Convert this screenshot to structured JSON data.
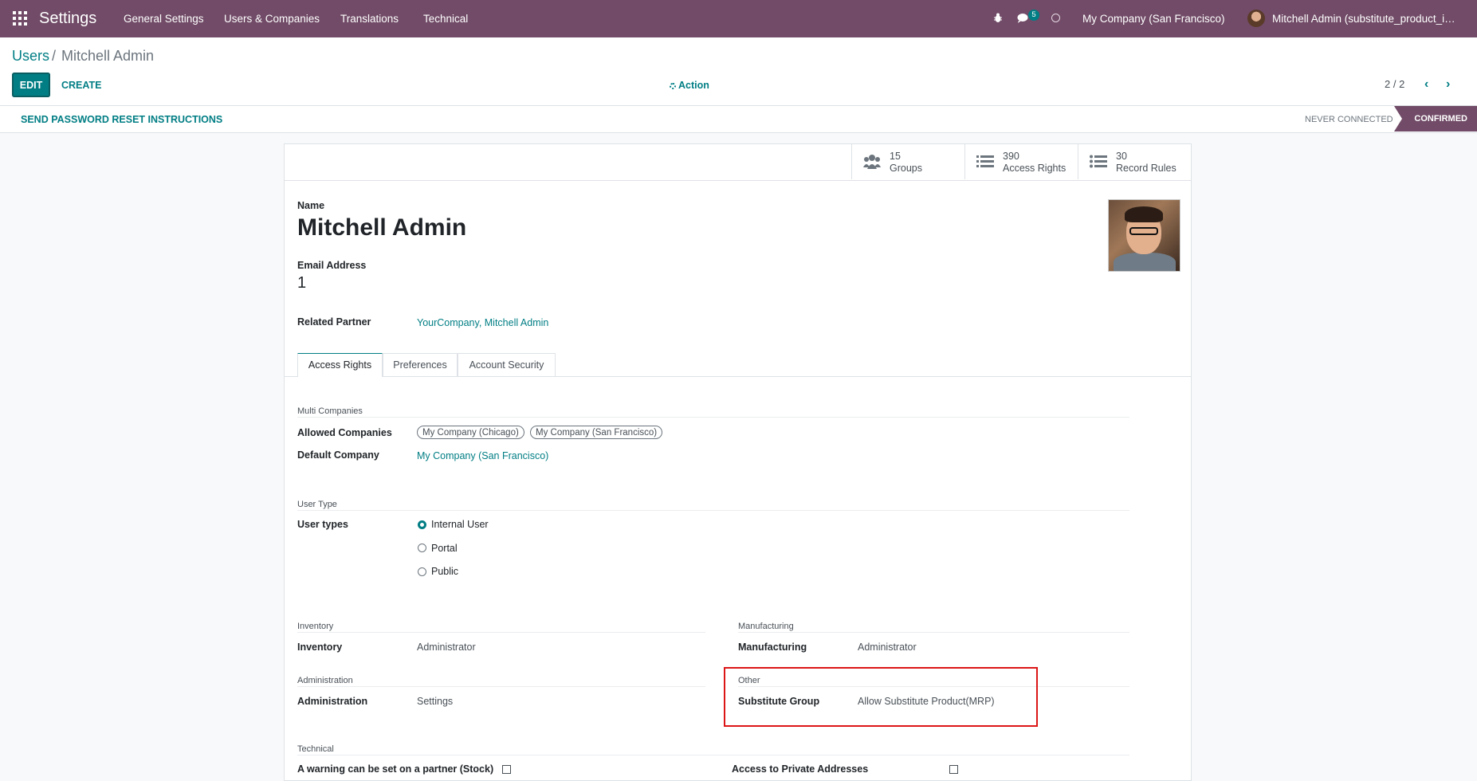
{
  "app": {
    "name": "Settings"
  },
  "top_menu": [
    "General Settings",
    "Users & Companies",
    "Translations",
    "Technical"
  ],
  "systray": {
    "chat_count": "5",
    "company": "My Company (San Francisco)",
    "user": "Mitchell Admin (substitute_product_in_..."
  },
  "breadcrumb": {
    "parent": "Users",
    "separator": "/",
    "current": "Mitchell Admin"
  },
  "buttons": {
    "edit": "EDIT",
    "create": "CREATE",
    "action": "Action",
    "reset_password": "SEND PASSWORD RESET INSTRUCTIONS"
  },
  "pager": {
    "value": "2 / 2"
  },
  "status": {
    "never_connected": "NEVER CONNECTED",
    "confirmed": "CONFIRMED"
  },
  "stats": [
    {
      "value": "15",
      "label": "Groups"
    },
    {
      "value": "390",
      "label": "Access Rights"
    },
    {
      "value": "30",
      "label": "Record Rules"
    }
  ],
  "form": {
    "name_label": "Name",
    "name": "Mitchell Admin",
    "email_label": "Email Address",
    "email": "1",
    "partner_label": "Related Partner",
    "partner": "YourCompany, Mitchell Admin"
  },
  "tabs": [
    "Access Rights",
    "Preferences",
    "Account Security"
  ],
  "multi_companies": {
    "title": "Multi Companies",
    "allowed_label": "Allowed Companies",
    "allowed": [
      "My Company (Chicago)",
      "My Company (San Francisco)"
    ],
    "default_label": "Default Company",
    "default": "My Company (San Francisco)"
  },
  "user_type": {
    "title": "User Type",
    "label": "User types",
    "options": [
      "Internal User",
      "Portal",
      "Public"
    ],
    "selected": "Internal User"
  },
  "groups": {
    "inventory": {
      "title": "Inventory",
      "label": "Inventory",
      "value": "Administrator"
    },
    "manufacturing": {
      "title": "Manufacturing",
      "label": "Manufacturing",
      "value": "Administrator"
    },
    "administration": {
      "title": "Administration",
      "label": "Administration",
      "value": "Settings"
    },
    "other": {
      "title": "Other",
      "label": "Substitute Group",
      "value": "Allow Substitute Product(MRP)"
    }
  },
  "technical": {
    "title": "Technical",
    "left_label": "A warning can be set on a partner (Stock)",
    "right_label": "Access to Private Addresses"
  }
}
